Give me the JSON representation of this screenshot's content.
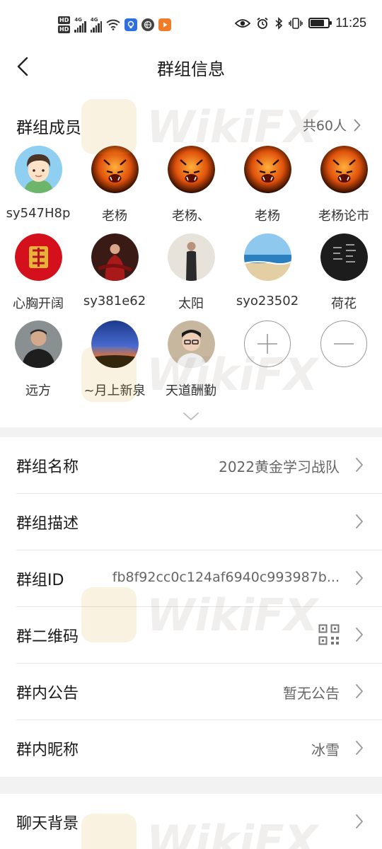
{
  "status_bar": {
    "hd1": "HD",
    "hd2": "HD",
    "net1": "4G",
    "net2": "4G",
    "time": "11:25"
  },
  "header": {
    "title": "群组信息"
  },
  "members": {
    "title": "群组成员",
    "count": "共60人",
    "list": [
      {
        "name": "sy547H8p",
        "avatar": "cartoon-boy"
      },
      {
        "name": "老杨",
        "avatar": "tiger"
      },
      {
        "name": "老杨、",
        "avatar": "tiger"
      },
      {
        "name": "老杨",
        "avatar": "tiger"
      },
      {
        "name": "老杨论市",
        "avatar": "tiger"
      },
      {
        "name": "心胸开阔",
        "avatar": "fu-character"
      },
      {
        "name": "sy381e62",
        "avatar": "woman-red-dress"
      },
      {
        "name": "太阳",
        "avatar": "person-standing"
      },
      {
        "name": "syo23502",
        "avatar": "beach"
      },
      {
        "name": "荷花",
        "avatar": "dark-text"
      },
      {
        "name": "远方",
        "avatar": "man-car"
      },
      {
        "name": "~月上新泉",
        "avatar": "sunset"
      },
      {
        "name": "天道酬勤",
        "avatar": "man-glasses"
      }
    ],
    "add_icon": "plus-icon",
    "remove_icon": "minus-icon"
  },
  "settings": {
    "group_name": {
      "label": "群组名称",
      "value": "2022黄金学习战队"
    },
    "group_desc": {
      "label": "群组描述",
      "value": ""
    },
    "group_id": {
      "label": "群组ID",
      "value": "fb8f92cc0c124af6940c993987b..."
    },
    "qr_code": {
      "label": "群二维码",
      "icon": "qr-code-icon"
    },
    "announcement": {
      "label": "群内公告",
      "value": "暂无公告"
    },
    "nickname": {
      "label": "群内昵称",
      "value": "冰雪"
    },
    "chat_bg": {
      "label": "聊天背景",
      "value": ""
    }
  },
  "watermark": {
    "text": "WikiFX"
  },
  "colors": {
    "divider": "#e6e6e6",
    "section_gap": "#f2f2f2",
    "secondary_text": "#666666"
  }
}
